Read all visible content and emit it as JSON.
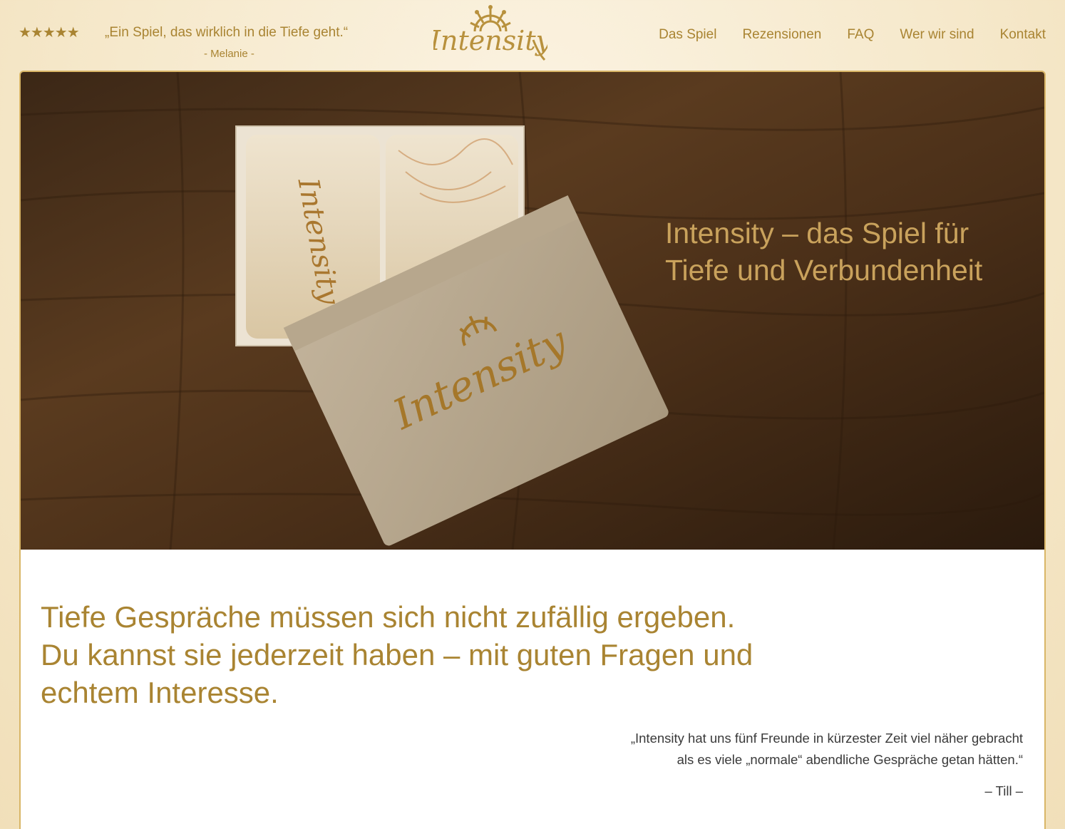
{
  "header": {
    "rating_stars": "★★★★★",
    "review_quote": "„Ein Spiel, das wirklich in die Tiefe geht.“",
    "review_author": "- Melanie -",
    "logo_text": "Intensity"
  },
  "nav": {
    "items": [
      "Das Spiel",
      "Rezensionen",
      "FAQ",
      "Wer wir sind",
      "Kontakt"
    ]
  },
  "hero": {
    "title": "Intensity – das Spiel für Tiefe und Verbundenheit",
    "box_logo_text": "Intensity"
  },
  "content": {
    "headline_lines": [
      "Tiefe Gespräche müssen sich nicht zufällig ergeben.",
      "Du kannst sie jederzeit haben – mit guten Fragen und",
      "echtem Interesse."
    ],
    "testimonial_lines": [
      "„Intensity hat uns fünf Freunde in kürzester Zeit viel näher gebracht",
      "als es viele „normale“ abendliche Gespräche getan hätten.“"
    ],
    "testimonial_author": "– Till –"
  },
  "colors": {
    "accent": "#a98432",
    "hero_title": "#c9a25c",
    "frame_border": "#d9b667",
    "body_text": "#3a3a3a"
  }
}
